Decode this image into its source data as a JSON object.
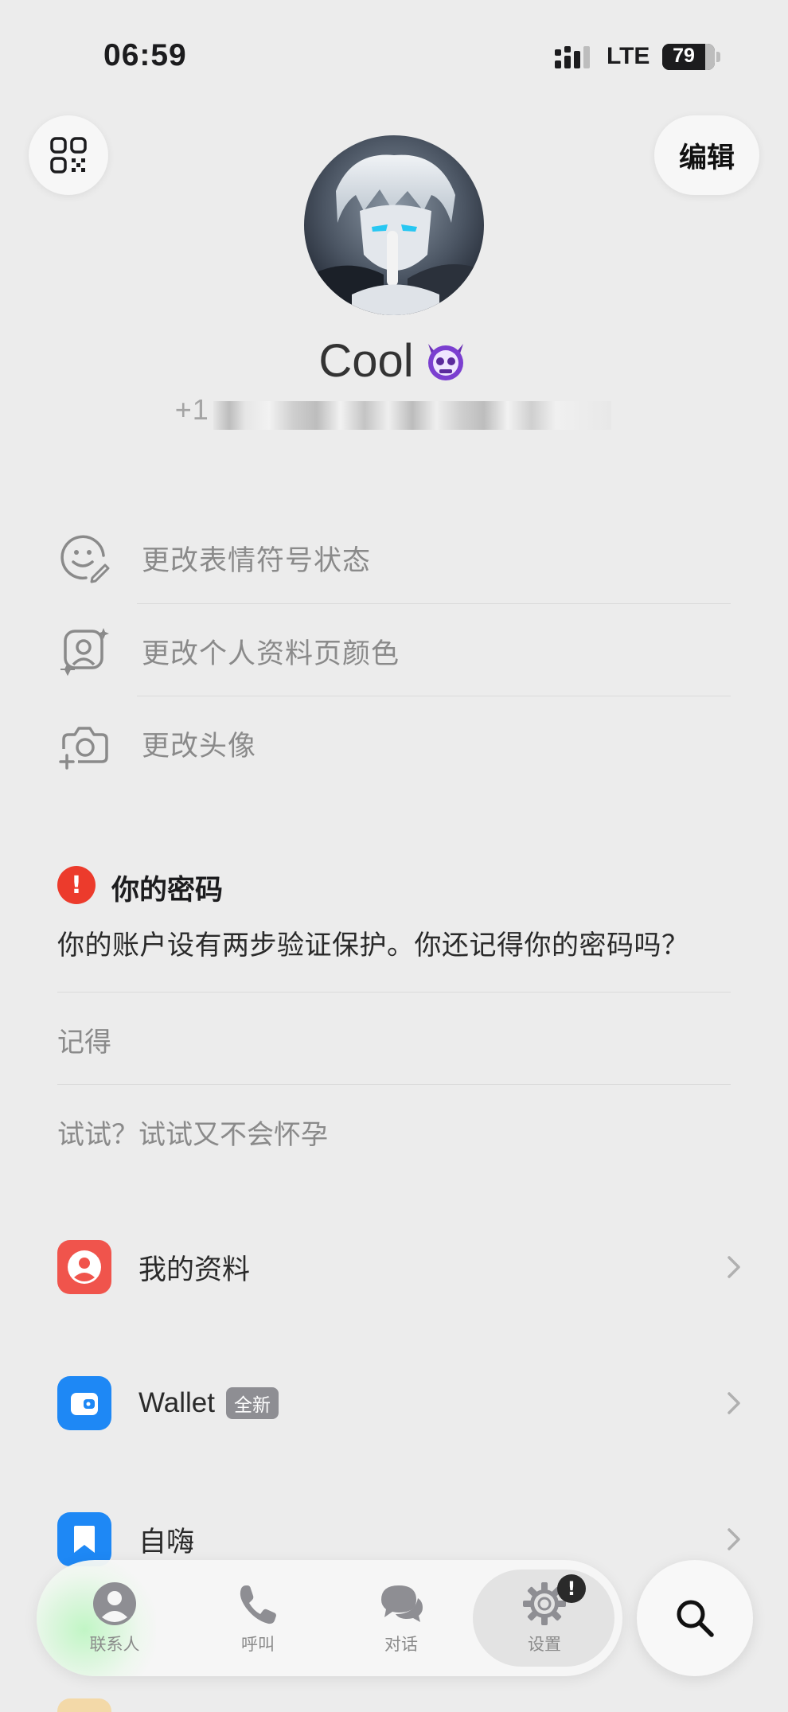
{
  "status_bar": {
    "time": "06:59",
    "network": "LTE",
    "battery": "79",
    "battery_level": 0.79
  },
  "header": {
    "edit_label": "编辑",
    "qr_icon": "qr-code-icon"
  },
  "profile": {
    "name": "Cool",
    "name_badge_icon": "purple-devil-skull-emoji",
    "phone_prefix": "+1"
  },
  "options": [
    {
      "label": "更改表情符号状态",
      "icon": "emoji-smile-pencil-icon"
    },
    {
      "label": "更改个人资料页颜色",
      "icon": "profile-color-sparkle-icon"
    },
    {
      "label": "更改头像",
      "icon": "camera-plus-icon"
    }
  ],
  "password_card": {
    "title": "你的密码",
    "body": "你的账户设有两步验证保护。你还记得你的密码吗？",
    "answers": [
      "记得",
      "试试？试试又不会怀孕"
    ],
    "warn_color": "#ec3b2c"
  },
  "menu": [
    {
      "label": "我的资料",
      "icon": "person-circle-icon",
      "color": "#f0544c"
    },
    {
      "label": "Wallet",
      "badge": "全新",
      "icon": "wallet-icon",
      "color": "#1e88f5"
    },
    {
      "label": "自嗨",
      "icon": "bookmark-icon",
      "color": "#1e88f5"
    }
  ],
  "tabs": [
    {
      "label": "联系人",
      "icon": "contacts-icon"
    },
    {
      "label": "呼叫",
      "icon": "phone-icon"
    },
    {
      "label": "对话",
      "icon": "chat-bubbles-icon"
    },
    {
      "label": "设置",
      "icon": "gear-icon",
      "active": true,
      "badge": "!"
    }
  ]
}
